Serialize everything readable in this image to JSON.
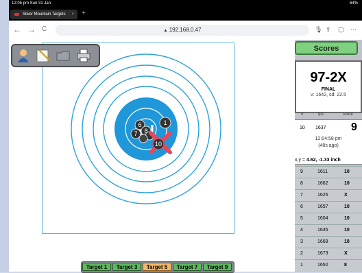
{
  "status": {
    "time": "12:05 pm  Sun 31 Jan",
    "battery": "64%"
  },
  "browser": {
    "tab_title": "Silver Mountain Targets",
    "tab_close": "×",
    "new_tab": "+",
    "back": "←",
    "forward": "→",
    "reload": "C",
    "url": "192.168.0.47",
    "more": "···"
  },
  "targets": [
    "Target 1",
    "Target 3",
    "Target 5",
    "Target 7",
    "Target 9"
  ],
  "active_target": "Target 5",
  "shots_on_target": [
    "6",
    "7",
    "8",
    "1",
    "10"
  ],
  "panel": {
    "scores_button": "Scores",
    "total": "97-2X",
    "final_label": "FINAL",
    "velocity_stats": "v: 1642, sd: 22.5",
    "header": {
      "num": "#",
      "fps": "fps",
      "score": "score"
    },
    "last_shot": {
      "num": "10",
      "fps": "1637",
      "score": "9",
      "time": "12:04:58 pm",
      "ago": "(48s ago)",
      "xy_label": "x,y =",
      "xy_value": "4.62, -1.33 inch"
    },
    "rows": [
      {
        "num": "9",
        "fps": "1611",
        "score": "10"
      },
      {
        "num": "8",
        "fps": "1662",
        "score": "10"
      },
      {
        "num": "7",
        "fps": "1625",
        "score": "X"
      },
      {
        "num": "6",
        "fps": "1657",
        "score": "10"
      },
      {
        "num": "5",
        "fps": "1604",
        "score": "10"
      },
      {
        "num": "4",
        "fps": "1635",
        "score": "10"
      },
      {
        "num": "3",
        "fps": "1668",
        "score": "10"
      },
      {
        "num": "2",
        "fps": "1673",
        "score": "X"
      },
      {
        "num": "1",
        "fps": "1650",
        "score": "8"
      }
    ]
  }
}
